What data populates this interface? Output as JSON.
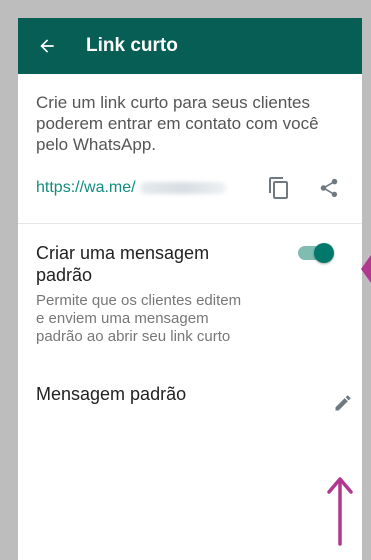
{
  "header": {
    "title": "Link curto"
  },
  "description": "Crie um link curto para seus clientes poderem entrar em contato com você pelo WhatsApp.",
  "link": {
    "prefix": "https://wa.me/"
  },
  "default_message_setting": {
    "title": "Criar uma mensagem padrão",
    "subtitle": "Permite que os clientes editem e enviem uma mensagem padrão ao abrir seu link curto",
    "enabled": true
  },
  "default_message": {
    "label": "Mensagem padrão"
  },
  "icons": {
    "back": "arrow-left-icon",
    "copy": "copy-icon",
    "share": "share-icon",
    "edit": "pencil-icon"
  },
  "colors": {
    "appbar": "#075e54",
    "link": "#128c7e",
    "toggle_on": "#00796b",
    "annotation": "#b0388f"
  }
}
